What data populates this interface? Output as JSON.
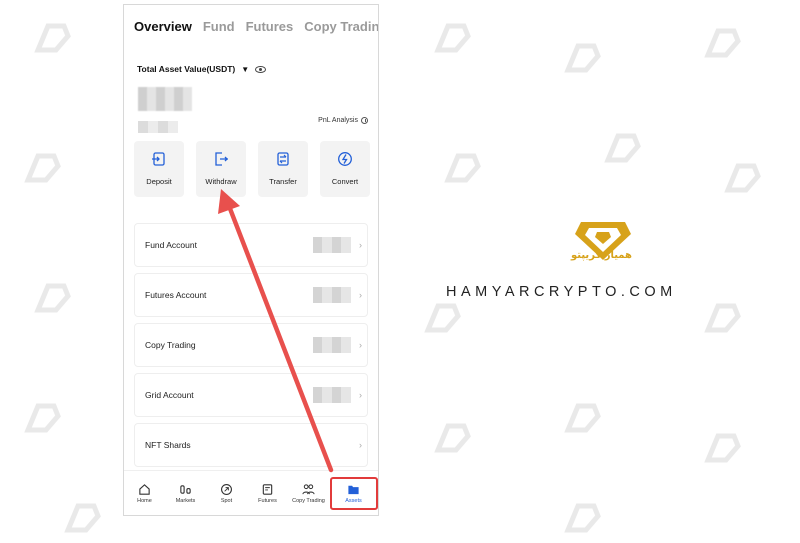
{
  "tabs": [
    "Overview",
    "Fund",
    "Futures",
    "Copy Trading"
  ],
  "asset": {
    "label": "Total Asset Value(USDT)",
    "pnl_label": "PnL Analysis"
  },
  "actions": [
    {
      "label": "Deposit",
      "icon": "deposit-icon"
    },
    {
      "label": "Withdraw",
      "icon": "withdraw-icon"
    },
    {
      "label": "Transfer",
      "icon": "transfer-icon"
    },
    {
      "label": "Convert",
      "icon": "convert-icon"
    }
  ],
  "accounts": [
    {
      "name": "Fund Account",
      "blurred": true
    },
    {
      "name": "Futures Account",
      "blurred": true
    },
    {
      "name": "Copy Trading",
      "blurred": true
    },
    {
      "name": "Grid Account",
      "blurred": true
    },
    {
      "name": "NFT Shards",
      "blurred": false
    }
  ],
  "nav": [
    {
      "label": "Home",
      "icon": "home-icon"
    },
    {
      "label": "Markets",
      "icon": "markets-icon"
    },
    {
      "label": "Spot",
      "icon": "spot-icon"
    },
    {
      "label": "Futures",
      "icon": "futures-icon"
    },
    {
      "label": "Copy Trading",
      "icon": "copy-trading-icon"
    },
    {
      "label": "Assets",
      "icon": "assets-icon",
      "active": true
    }
  ],
  "brand": {
    "logo_text": "همیار کریپتو",
    "domain": "HAMYARCRYPTO.COM",
    "accent_color": "#d7a21a"
  },
  "colors": {
    "highlight": "#e23b3b",
    "active_nav": "#2360d8"
  }
}
